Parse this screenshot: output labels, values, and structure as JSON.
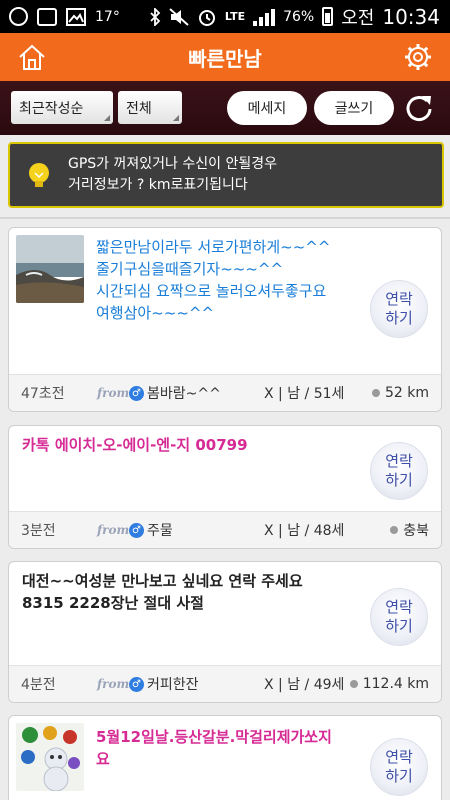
{
  "status_bar": {
    "temperature": "17°",
    "battery": "76%",
    "network": "LTE",
    "ampm": "오전",
    "time": "10:34"
  },
  "header": {
    "title": "빠른만남"
  },
  "toolbar": {
    "sort_label": "최근작성순",
    "filter_label": "전체",
    "message_label": "메세지",
    "write_label": "글쓰기"
  },
  "notice": {
    "line1": "GPS가 꺼져있거나 수신이 안될경우",
    "line2": "거리정보가 ? km로표기됩니다"
  },
  "from_label": "from.",
  "gender_symbol": "♂",
  "posts": [
    {
      "message": "짧은만남이라두 서로가편하게~~^^\n줄기구심을때즐기자~~~^^\n시간되심 요짝으로 놀러오셔두좋구요\n여행삼아~~~^^",
      "contact_label": "연락\n하기",
      "time": "47초전",
      "nickname": "봄바람~^^",
      "age": "X | 남 / 51세",
      "location": "52 km"
    },
    {
      "message": "카톡 에이치-오-에이-엔-지 00799",
      "contact_label": "연락\n하기",
      "time": "3분전",
      "nickname": "주물",
      "age": "X | 남 / 48세",
      "location": "충북"
    },
    {
      "message": "대전~~여성분 만나보고 싶네요 연락 주세요\n8315 2228장난 절대 사절",
      "contact_label": "연락\n하기",
      "time": "4분전",
      "nickname": "커피한잔",
      "age": "X | 남 / 49세",
      "location": "112.4 km"
    },
    {
      "message": "5월12일날.등산갈분.막걸리제가쏘지\n요",
      "contact_label": "연락\n하기"
    }
  ],
  "colors": {
    "header": "#f26a1b",
    "toolbar": "#2f0d12",
    "notice_border": "#d9c500",
    "blue_text": "#1a7ed8",
    "pink_text": "#d62a94",
    "contact_text": "#3e4fa8"
  }
}
